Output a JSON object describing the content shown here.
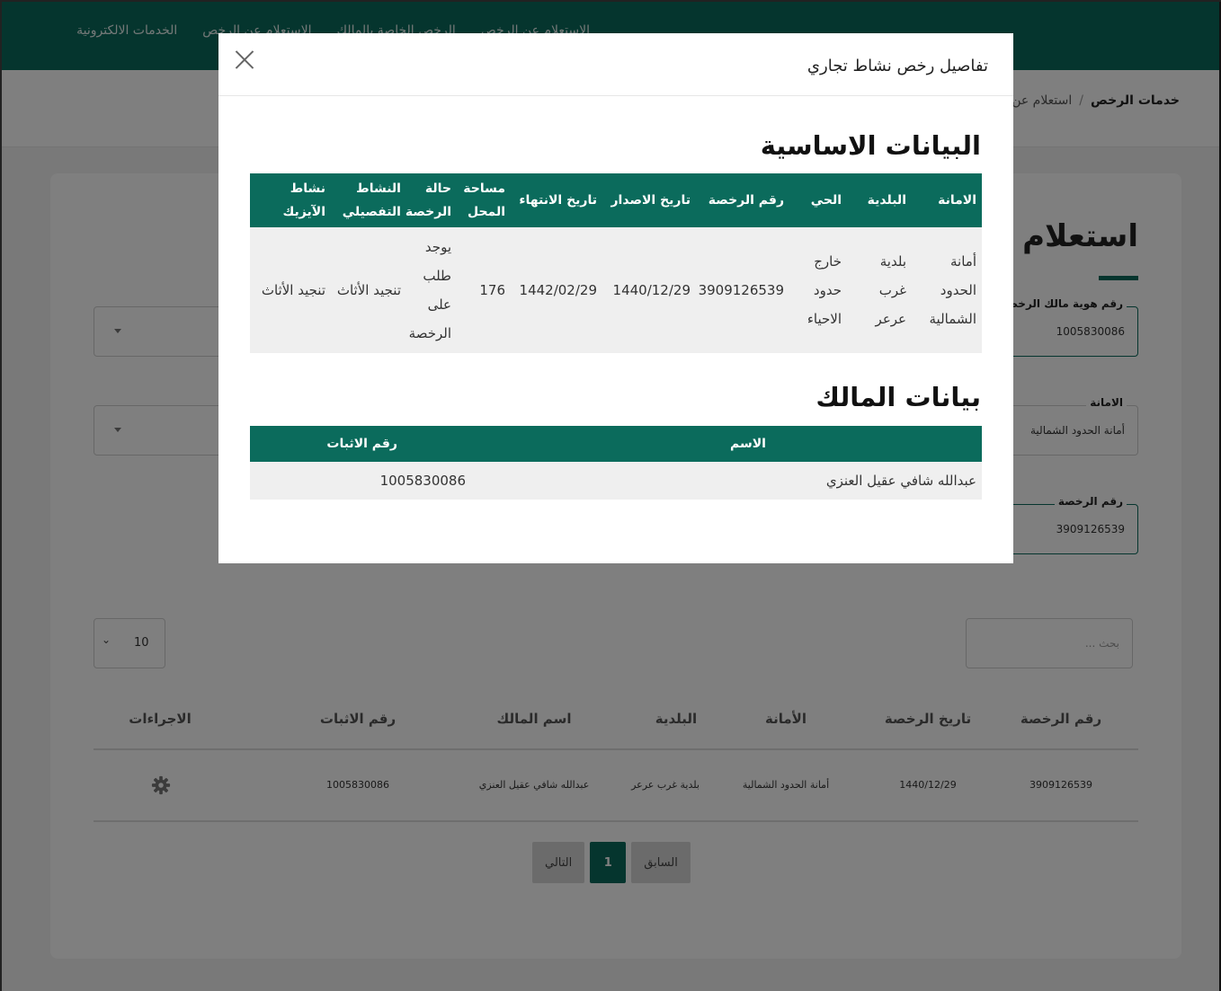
{
  "nav": {
    "items": [
      "الاستعلام عن الرخص",
      "الرخص الخاصة بالمالك",
      "الاستعلام عن الرخص",
      "الخدمات الالكترونية"
    ]
  },
  "breadcrumb": {
    "root": "خدمات الرخص",
    "separator": "/",
    "current": "استعلام عن"
  },
  "page": {
    "title": "استعلام عن"
  },
  "form": {
    "owner_id_label": "رقم هوية مالك الرخصة",
    "owner_id_value": "1005830086",
    "amana_label": "الامانة",
    "amana_value": "أمانة الحدود الشمالية",
    "license_no_label": "رقم الرخصة",
    "license_no_value": "3909126539"
  },
  "list": {
    "page_size": "10",
    "search_placeholder": "بحث ...",
    "columns": [
      "رقم الرخصة",
      "تاريخ الرخصة",
      "الأمانة",
      "البلدية",
      "اسم المالك",
      "رقم الاثبات",
      "الاجراءات"
    ],
    "rows": [
      {
        "license_no": "3909126539",
        "license_date": "1440/12/29",
        "amana": "أمانة الحدود الشمالية",
        "municipality": "بلدية غرب عرعر",
        "owner_name": "عبدالله شافي عقيل العنزي",
        "id_no": "1005830086"
      }
    ],
    "pagination": {
      "previous": "السابق",
      "current": "1",
      "next": "التالي"
    }
  },
  "modal": {
    "title": "تفاصيل رخص نشاط تجاري",
    "basic_section_title": "البيانات الاساسية",
    "basic_columns": [
      "الامانة",
      "البلدية",
      "الحي",
      "رقم الرخصة",
      "تاريخ الاصدار",
      "تاريخ الانتهاء",
      "مساحة المحل",
      "حالة الرخصة",
      "النشاط التفصيلي",
      "نشاط الآيزيك"
    ],
    "basic_row": [
      "أمانة الحدود الشمالية",
      "بلدية غرب عرعر",
      "خارج حدود الاحياء",
      "3909126539",
      "1440/12/29",
      "1442/02/29",
      "176",
      "يوجد طلب على الرخصة",
      "تنجيد الأثاث",
      "تنجيد الأثاث"
    ],
    "owner_section_title": "بيانات المالك",
    "owner_columns": [
      "الاسم",
      "رقم الاثبات"
    ],
    "owner_row": [
      "عبدالله شافي عقيل العنزي",
      "1005830086"
    ]
  },
  "colors": {
    "primary": "#0b6b5c",
    "row_bg": "#efefef",
    "overlay": "rgba(0,0,0,0.5)"
  }
}
